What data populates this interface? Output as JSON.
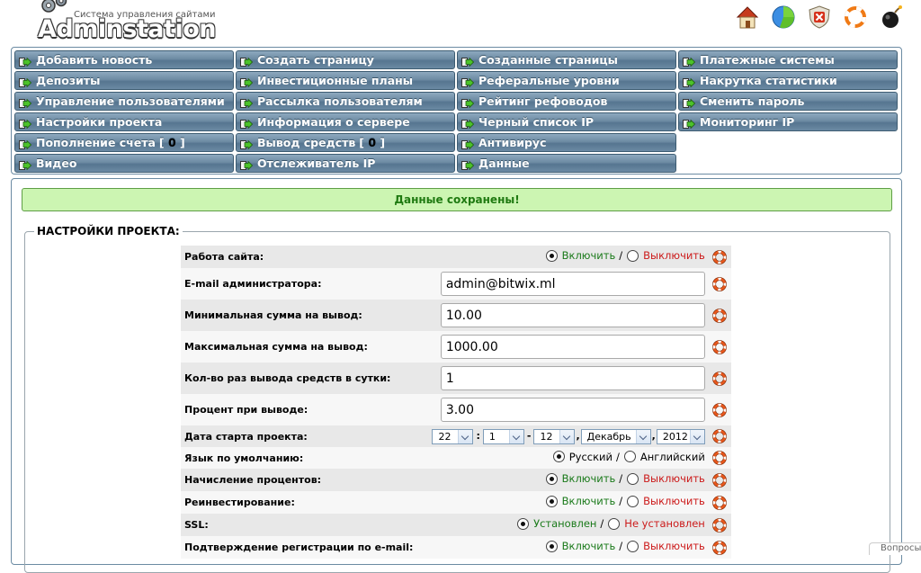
{
  "header": {
    "tagline": "Система управления сайтами",
    "brand": "Adminstation",
    "icons": [
      "home-icon",
      "statistics-icon",
      "security-shield-icon",
      "refresh-icon",
      "bomb-icon"
    ]
  },
  "nav": {
    "rows": [
      [
        "Добавить новость",
        "Создать страницу",
        "Созданные страницы",
        "Платежные системы"
      ],
      [
        "Депозиты",
        "Инвестиционные планы",
        "Реферальные уровни",
        "Накрутка статистики"
      ],
      [
        "Управление пользователями",
        "Рассылка пользователям",
        "Рейтинг рефоводов",
        "Сменить пароль"
      ],
      [
        "Настройки проекта",
        "Информация о сервере",
        "Черный список IP",
        "Мониторинг IP"
      ],
      [
        "Пополнение счета",
        "Вывод средств",
        "Антивирус",
        ""
      ],
      [
        "Видео",
        "Отслеживатель IP",
        "Данные",
        ""
      ]
    ],
    "deposit_count": "0",
    "withdraw_count": "0"
  },
  "status": {
    "message": "Данные сохранены!"
  },
  "settings": {
    "legend": "НАСТРОЙКИ ПРОЕКТА:",
    "site_work": {
      "label": "Работа сайта:",
      "on": "Включить",
      "off": "Выключить",
      "selected": "on"
    },
    "admin_email": {
      "label": "E-mail администратора:",
      "value": "admin@bitwix.ml"
    },
    "min_withdraw": {
      "label": "Минимальная сумма на вывод:",
      "value": "10.00"
    },
    "max_withdraw": {
      "label": "Максимальная сумма на вывод:",
      "value": "1000.00"
    },
    "withdraw_per_day": {
      "label": "Кол-во раз вывода средств в сутки:",
      "value": "1"
    },
    "withdraw_percent": {
      "label": "Процент при выводе:",
      "value": "3.00"
    },
    "start_date": {
      "label": "Дата старта проекта:",
      "hour": "22",
      "minute": "1",
      "day": "12",
      "month": "Декабрь",
      "year": "2012",
      "sep_time": ":",
      "sep_dash": "-",
      "sep_comma": ","
    },
    "default_language": {
      "label": "Язык по умолчанию:",
      "ru": "Русский",
      "en": "Английский",
      "selected": "ru"
    },
    "interest_accrual": {
      "label": "Начисление процентов:",
      "on": "Включить",
      "off": "Выключить",
      "selected": "on"
    },
    "reinvest": {
      "label": "Реинвестирование:",
      "on": "Включить",
      "off": "Выключить",
      "selected": "on"
    },
    "ssl": {
      "label": "SSL:",
      "on": "Установлен",
      "off": "Не установлен",
      "selected": "on"
    },
    "email_confirm": {
      "label": "Подтверждение регистрации по e-mail:",
      "on": "Включить",
      "off": "Выключить",
      "selected": "on"
    }
  },
  "corner_tab": "Вопросы"
}
